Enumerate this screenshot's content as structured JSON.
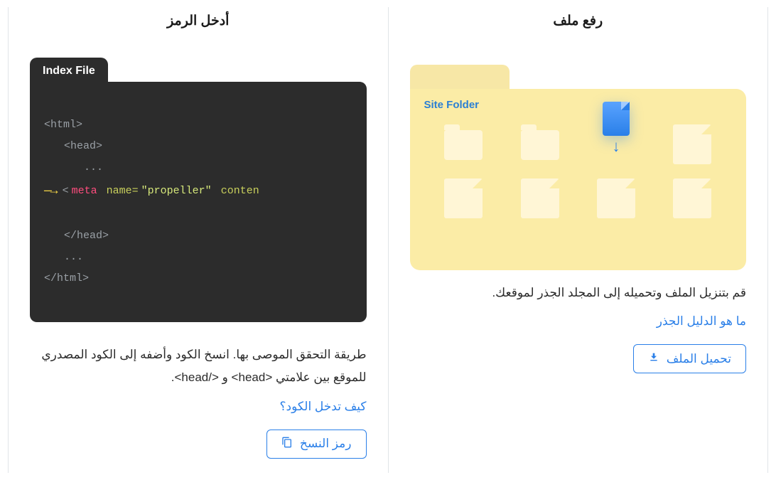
{
  "insert_code": {
    "title": "أدخل الرمز",
    "folder_label": "Index File",
    "code_lines": {
      "open_html": "<html>",
      "open_head": "<head>",
      "dots1": "...",
      "hl_open": "<",
      "hl_meta": "meta",
      "hl_name_attr": " name=",
      "hl_name_val": "\"propeller\"",
      "hl_conten": " conten",
      "close_head": "</head>",
      "dots2": "...",
      "close_html": "</html>"
    },
    "description": "طريقة التحقق الموصى بها. انسخ الكود وأضفه إلى الكود المصدري للموقع بين علامتي <head> و </head>.",
    "help_link": "كيف تدخل الكود؟",
    "button_label": "رمز النسخ"
  },
  "upload_file": {
    "title": "رفع ملف",
    "folder_label": "Site Folder",
    "description": "قم بتنزيل الملف وتحميله إلى المجلد الجذر لموقعك.",
    "help_link": "ما هو الدليل الجذر",
    "button_label": "تحميل الملف"
  }
}
